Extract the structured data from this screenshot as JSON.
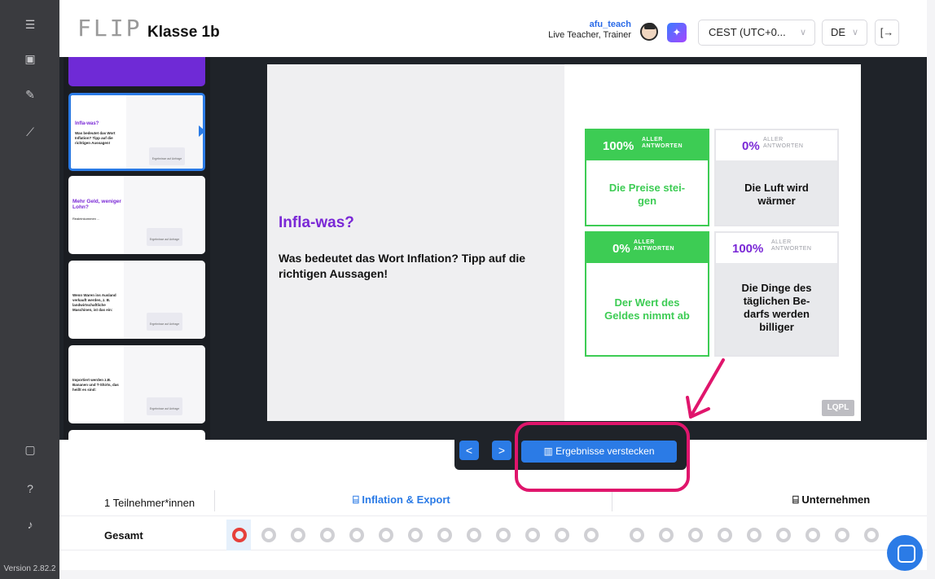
{
  "header": {
    "logo": "FLIP",
    "class_title": "Klasse 1b",
    "user_name": "afu_teach",
    "user_role": "Live Teacher, Trainer",
    "timezone": "CEST (UTC+0...",
    "language": "DE"
  },
  "thumbnails": [
    {
      "title": "",
      "body": ""
    },
    {
      "title": "Infla-was?",
      "body": "Was bedeutet das Wort Inflation? Tipp auf die richtigen Aussagen!",
      "mini": "Ergebnisse auf Anfrage"
    },
    {
      "title": "Mehr Geld, weniger Lohn?",
      "body": "Realeinkommen ... ",
      "mini": "Ergebnisse auf Anfrage"
    },
    {
      "title": "",
      "body": "Wenn Waren ins Ausland verkauft werden, z. B. landwirtschaftliche Maschinen, ist das ein:",
      "mini": "Ergebnisse auf Anfrage"
    },
    {
      "title": "",
      "body": "Importiert werden z.B. Bananen und T-Shirts, das heißt es sind:",
      "mini": "Ergebnisse auf Anfrage"
    }
  ],
  "slide": {
    "title": "Infla-was?",
    "question": "Was bedeutet das Wort Inflation? Tipp auf die richtigen Aussagen!",
    "watermark": "LQPL",
    "answers_word_top": "ALLER",
    "answers_word_bottom": "ANTWORTEN",
    "answers": [
      {
        "pct": "100%",
        "text": "Die Preise stei-gen",
        "correct": true
      },
      {
        "pct": "0%",
        "text": "Die Luft wird wärmer",
        "correct": false
      },
      {
        "pct": "0%",
        "text": "Der Wert des Geldes nimmt ab",
        "correct": true
      },
      {
        "pct": "100%",
        "text": "Die Dinge des täglichen Be-darfs werden billiger",
        "correct": false
      }
    ]
  },
  "controls": {
    "prev": "<",
    "next": ">",
    "toggle_results": "Ergebnisse verstecken"
  },
  "progress": {
    "participants": "1 Teilnehmer*innen",
    "tab_inflation": "Inflation & Export",
    "tab_company": "Unternehmen",
    "row_label": "Gesamt"
  },
  "sidebar": {
    "version": "Version 2.82.2"
  },
  "colors": {
    "accent": "#2b7be6",
    "correct": "#3dcc54",
    "purple": "#7a28d6",
    "highlight": "#e0156c"
  }
}
